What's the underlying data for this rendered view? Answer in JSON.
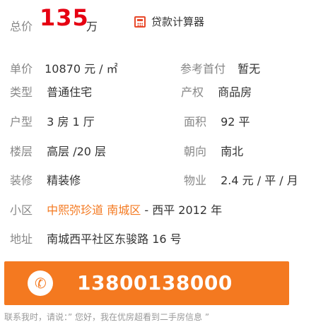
{
  "price": {
    "label": "总价",
    "value": "135",
    "unit": "万"
  },
  "calculator": {
    "icon": "calculator-icon",
    "label": "贷款计算器"
  },
  "details": {
    "unit_price": {
      "label": "单价",
      "value": "10870 元 / ㎡"
    },
    "down_payment": {
      "label": "参考首付",
      "value": "暂无"
    },
    "type": {
      "label": "类型",
      "value": "普通住宅"
    },
    "property_right": {
      "label": "产权",
      "value": "商品房"
    },
    "layout": {
      "label": "户型",
      "value": "3 房 1 厅"
    },
    "area": {
      "label": "面积",
      "value": "92 平"
    },
    "floor": {
      "label": "楼层",
      "value": "高层 /20 层"
    },
    "orientation": {
      "label": "朝向",
      "value": "南北"
    },
    "decoration": {
      "label": "装修",
      "value": "精装修"
    },
    "property_fee": {
      "label": "物业",
      "value": "2.4 元 / 平 / 月"
    },
    "community": {
      "label": "小区",
      "name": "中熙弥珍道",
      "district": "南城区",
      "suffix": "- 西平 2012 年"
    },
    "address": {
      "label": "地址",
      "value": "南城西平社区东骏路 16 号"
    }
  },
  "contact": {
    "phone_icon": "phone-icon",
    "phone": "13800138000",
    "note": "联系我时，请说：” 您好，我在优房超看到二手房信息 ”"
  },
  "colors": {
    "accent": "#f47920",
    "price": "#e60012",
    "calculator_icon": "#e8492b"
  }
}
